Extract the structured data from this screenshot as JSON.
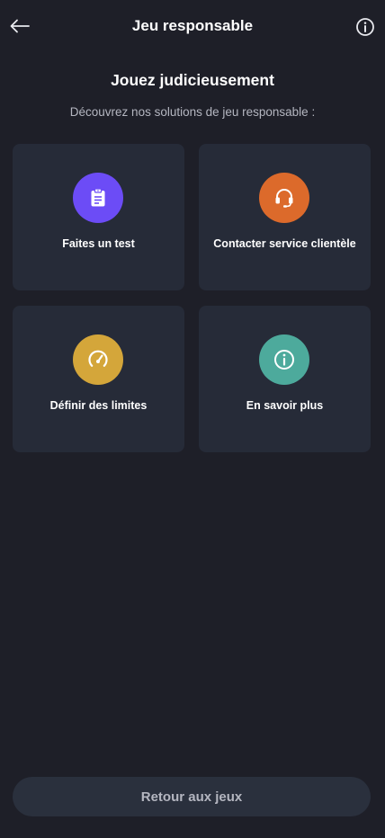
{
  "header": {
    "title": "Jeu responsable",
    "back_icon": "arrow-left-icon",
    "info_icon": "info-circle-icon"
  },
  "intro": {
    "title": "Jouez judicieusement",
    "subtitle": "Découvrez nos solutions de jeu responsable :"
  },
  "cards": [
    {
      "label": "Faites un test",
      "icon": "clipboard-icon",
      "color": "#6c4cf6"
    },
    {
      "label": "Contacter service clientèle",
      "icon": "headset-icon",
      "color": "#dc6a2b"
    },
    {
      "label": "Définir des limites",
      "icon": "speedometer-icon",
      "color": "#d4a63a"
    },
    {
      "label": "En savoir plus",
      "icon": "info-icon",
      "color": "#4daa9c"
    }
  ],
  "footer": {
    "back_to_games_label": "Retour aux jeux"
  }
}
